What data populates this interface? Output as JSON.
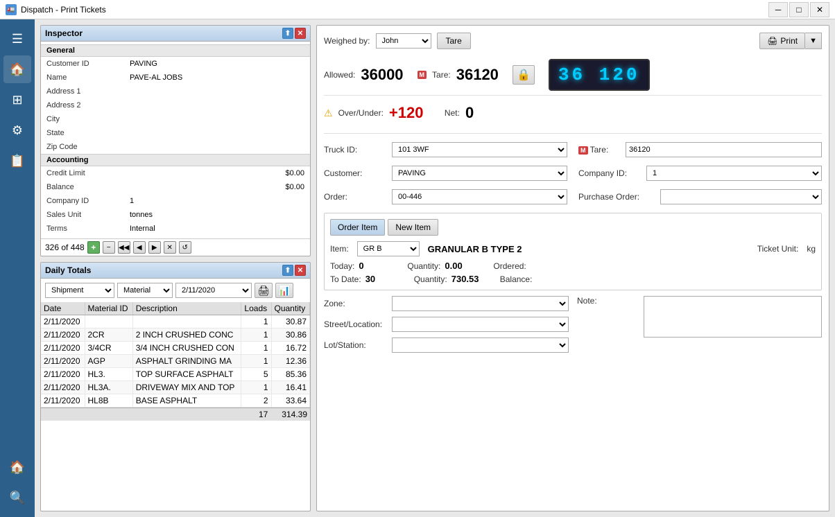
{
  "titlebar": {
    "title": "Dispatch - Print Tickets",
    "icon": "🚛"
  },
  "sidebar": {
    "items": [
      {
        "icon": "☰",
        "name": "menu"
      },
      {
        "icon": "🏠",
        "name": "home"
      },
      {
        "icon": "⊞",
        "name": "grid"
      },
      {
        "icon": "⚙",
        "name": "settings"
      },
      {
        "icon": "📋",
        "name": "clipboard"
      },
      {
        "icon": "🏠",
        "name": "home2"
      },
      {
        "icon": "🔍",
        "name": "search"
      }
    ]
  },
  "inspector": {
    "title": "Inspector",
    "general_label": "General",
    "accounting_label": "Accounting",
    "fields": {
      "customer_id_label": "Customer ID",
      "customer_id_value": "PAVING",
      "name_label": "Name",
      "name_value": "PAVE-AL JOBS",
      "address1_label": "Address 1",
      "address1_value": "",
      "address2_label": "Address 2",
      "address2_value": "",
      "city_label": "City",
      "city_value": "",
      "state_label": "State",
      "state_value": "",
      "zip_label": "Zip Code",
      "zip_value": "",
      "credit_limit_label": "Credit Limit",
      "credit_limit_value": "$0.00",
      "balance_label": "Balance",
      "balance_value": "$0.00",
      "company_id_label": "Company ID",
      "company_id_value": "1",
      "sales_unit_label": "Sales Unit",
      "sales_unit_value": "tonnes",
      "terms_label": "Terms",
      "terms_value": "Internal"
    },
    "nav": {
      "record": "326 of 448"
    }
  },
  "daily_totals": {
    "title": "Daily Totals",
    "type_options": [
      "Shipment"
    ],
    "type_selected": "Shipment",
    "material_options": [
      "Material"
    ],
    "material_selected": "Material",
    "date_selected": "2/11/2020",
    "columns": [
      "Date",
      "Material ID",
      "Description",
      "Loads",
      "Quantity"
    ],
    "rows": [
      {
        "date": "2/11/2020",
        "mat_id": "",
        "description": "",
        "loads": "1",
        "qty": "30.87"
      },
      {
        "date": "2/11/2020",
        "mat_id": "2CR",
        "description": "2 INCH CRUSHED CONC",
        "loads": "1",
        "qty": "30.86"
      },
      {
        "date": "2/11/2020",
        "mat_id": "3/4CR",
        "description": "3/4 INCH CRUSHED CON",
        "loads": "1",
        "qty": "16.72"
      },
      {
        "date": "2/11/2020",
        "mat_id": "AGP",
        "description": "ASPHALT GRINDING MA",
        "loads": "1",
        "qty": "12.36"
      },
      {
        "date": "2/11/2020",
        "mat_id": "HL3.",
        "description": "TOP SURFACE ASPHALT",
        "loads": "5",
        "qty": "85.36"
      },
      {
        "date": "2/11/2020",
        "mat_id": "HL3A.",
        "description": "DRIVEWAY MIX AND TOP",
        "loads": "1",
        "qty": "16.41"
      },
      {
        "date": "2/11/2020",
        "mat_id": "HL8B",
        "description": "BASE ASPHALT",
        "loads": "2",
        "qty": "33.64"
      }
    ],
    "footer_loads": "17",
    "footer_qty": "314.39"
  },
  "main": {
    "weighed_by_label": "Weighed by:",
    "weighed_by_value": "John",
    "tare_btn": "Tare",
    "print_btn": "Print",
    "allowed_label": "Allowed:",
    "allowed_value": "36000",
    "tare_label": "Tare:",
    "tare_value": "36120",
    "over_under_label": "Over/Under:",
    "over_under_value": "+120",
    "net_label": "Net:",
    "net_value": "0",
    "digital_value": "36 120",
    "truck_id_label": "Truck ID:",
    "truck_id_value": "101 3WF",
    "tare_m_label": "Tare:",
    "tare_m_value": "36120",
    "customer_label": "Customer:",
    "customer_value": "PAVING",
    "company_id_label": "Company ID:",
    "company_id_value": "1",
    "order_label": "Order:",
    "order_value": "00-446",
    "purchase_order_label": "Purchase Order:",
    "purchase_order_value": "",
    "order_item_btn": "Order Item",
    "new_item_btn": "New Item",
    "item_label": "Item:",
    "item_value": "GR B",
    "item_name": "GRANULAR B TYPE 2",
    "ticket_unit_label": "Ticket Unit:",
    "ticket_unit_value": "kg",
    "today_label": "Today:",
    "today_value": "0",
    "quantity_label": "Quantity:",
    "quantity_today_value": "0.00",
    "ordered_label": "Ordered:",
    "ordered_value": "",
    "to_date_label": "To Date:",
    "to_date_value": "30",
    "quantity_to_date_label": "Quantity:",
    "quantity_to_date_value": "730.53",
    "balance_label": "Balance:",
    "balance_value": "",
    "zone_label": "Zone:",
    "zone_value": "",
    "note_label": "Note:",
    "note_value": "",
    "street_label": "Street/Location:",
    "street_value": "",
    "lot_label": "Lot/Station:",
    "lot_value": ""
  }
}
